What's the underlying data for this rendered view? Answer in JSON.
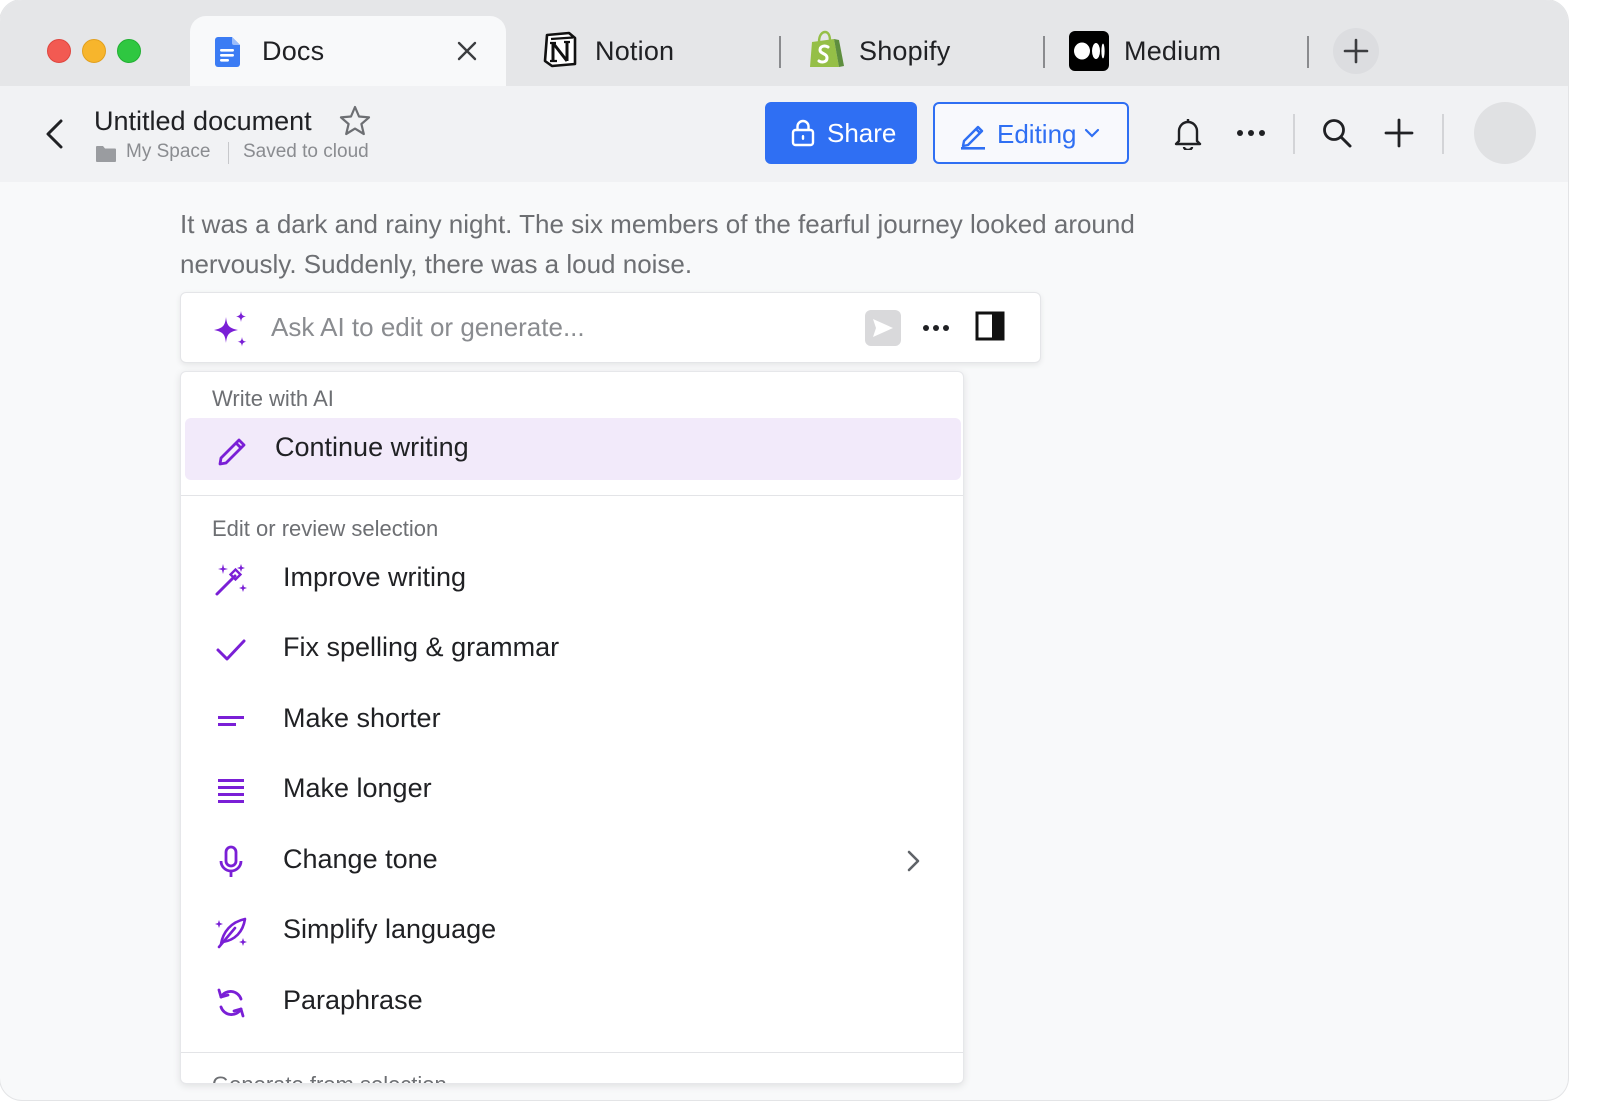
{
  "tabs": [
    {
      "label": "Docs",
      "active": true,
      "icon": "docs-icon"
    },
    {
      "label": "Notion",
      "active": false,
      "icon": "notion-icon"
    },
    {
      "label": "Shopify",
      "active": false,
      "icon": "shopify-icon"
    },
    {
      "label": "Medium",
      "active": false,
      "icon": "medium-icon"
    }
  ],
  "toolbar": {
    "doc_title": "Untitled document",
    "breadcrumb": "My Space",
    "status": "Saved to cloud",
    "share_label": "Share",
    "edit_label": "Editing"
  },
  "document": {
    "body": "It was a dark and rainy night. The six members of the fearful journey looked around nervously. Suddenly, there was a loud noise."
  },
  "ai_bar": {
    "placeholder": "Ask AI to edit or generate..."
  },
  "menu": {
    "section_write": "Write with AI",
    "continue": "Continue writing",
    "section_edit": "Edit or review selection",
    "items": [
      {
        "label": "Improve writing",
        "icon": "magic-wand-icon"
      },
      {
        "label": "Fix spelling & grammar",
        "icon": "check-icon"
      },
      {
        "label": "Make shorter",
        "icon": "short-lines-icon"
      },
      {
        "label": "Make longer",
        "icon": "long-lines-icon"
      },
      {
        "label": "Change tone",
        "icon": "microphone-icon"
      },
      {
        "label": "Simplify language",
        "icon": "feather-icon"
      },
      {
        "label": "Paraphrase",
        "icon": "refresh-icon"
      }
    ],
    "section_generate": "Generate from selection"
  },
  "colors": {
    "accent_blue": "#2f6ff3",
    "ai_purple": "#7a1fd6",
    "selected_bg": "#f2eafa"
  }
}
